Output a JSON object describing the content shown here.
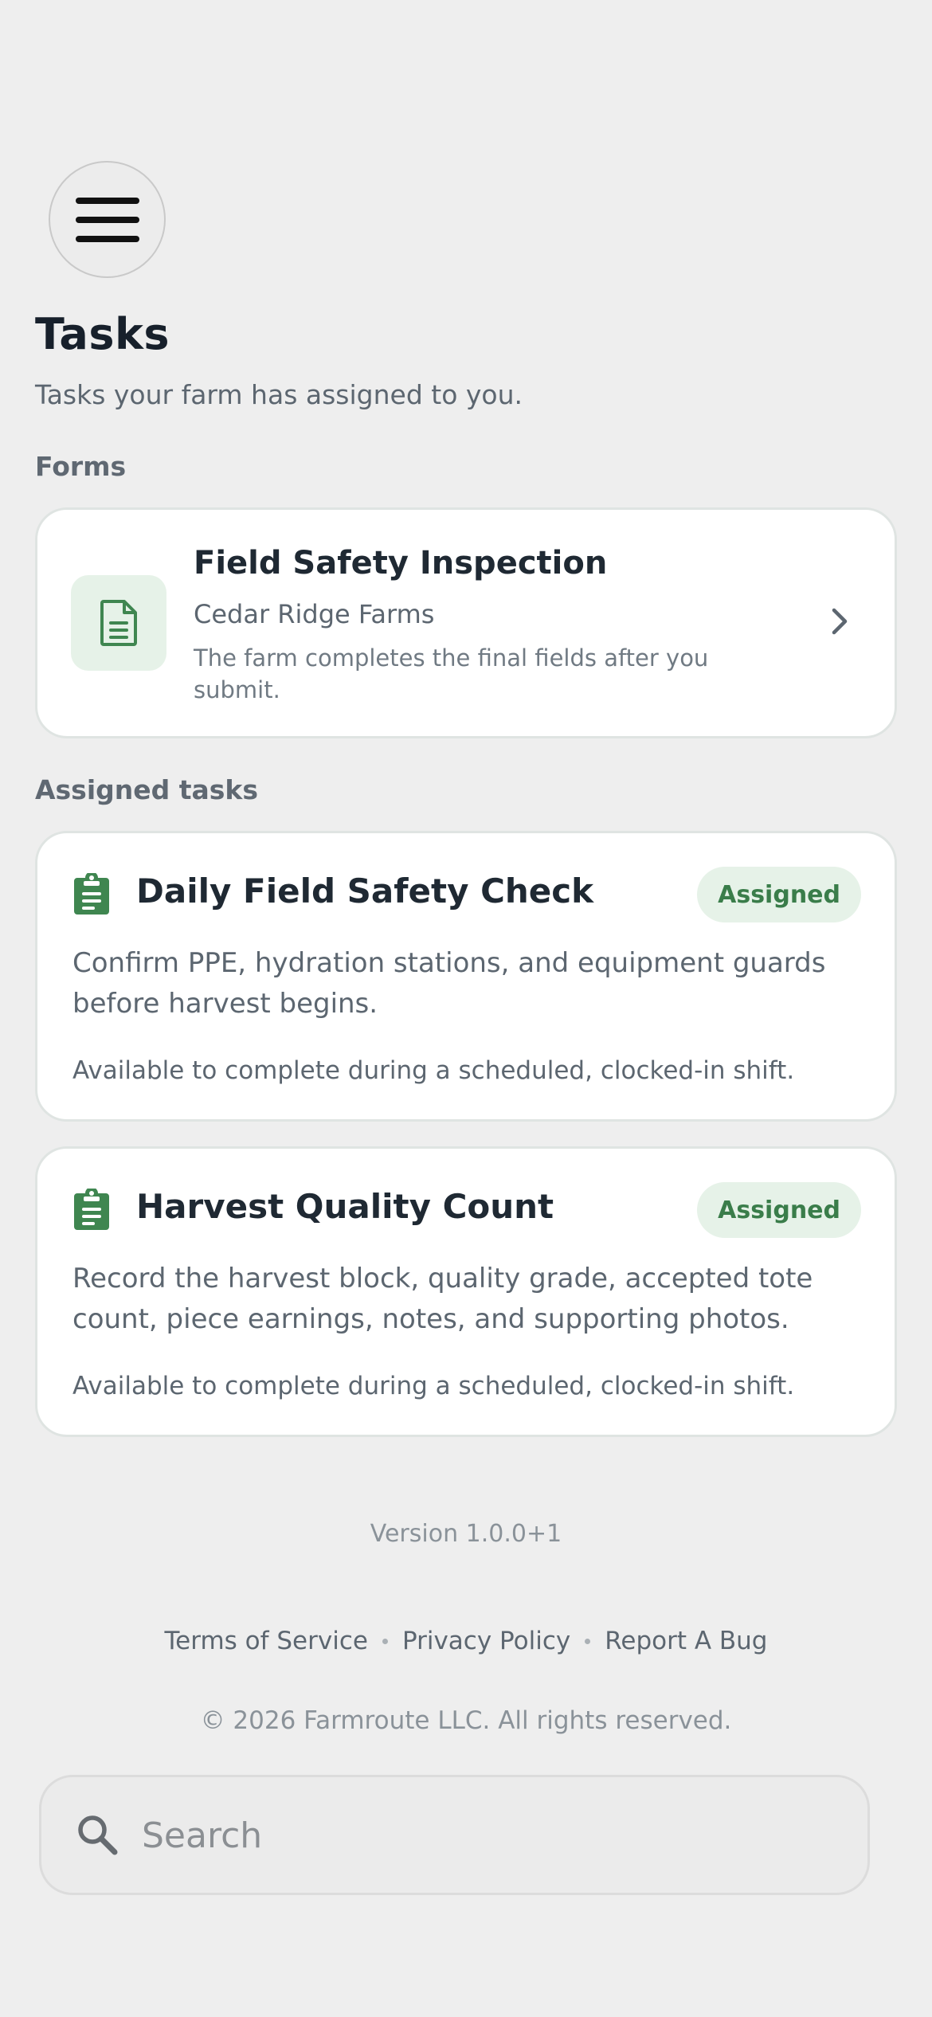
{
  "header": {
    "menu_icon": "hamburger-menu-icon",
    "title": "Tasks",
    "subtitle": "Tasks your farm has assigned to you."
  },
  "forms_section": {
    "label": "Forms",
    "items": [
      {
        "icon": "document-icon",
        "title": "Field Safety Inspection",
        "farm": "Cedar Ridge Farms",
        "note": "The farm completes the final fields after you submit.",
        "chevron_icon": "chevron-right-icon"
      }
    ]
  },
  "tasks_section": {
    "label": "Assigned tasks",
    "items": [
      {
        "icon": "clipboard-icon",
        "title": "Daily Field Safety Check",
        "status": "Assigned",
        "description": "Confirm PPE, hydration stations, and equipment guards before harvest begins.",
        "availability": "Available to complete during a scheduled, clocked-in shift."
      },
      {
        "icon": "clipboard-icon",
        "title": "Harvest Quality Count",
        "status": "Assigned",
        "description": "Record the harvest block, quality grade, accepted tote count, piece earnings, notes, and supporting photos.",
        "availability": "Available to complete during a scheduled, clocked-in shift."
      }
    ]
  },
  "footer": {
    "version": "Version 1.0.0+1",
    "links": {
      "terms": "Terms of Service",
      "privacy": "Privacy Policy",
      "bug": "Report A Bug"
    },
    "copyright": "© 2026 Farmroute LLC. All rights reserved."
  },
  "search": {
    "icon": "search-icon",
    "placeholder": "Search",
    "value": ""
  },
  "colors": {
    "background": "#eeeeee",
    "card": "#ffffff",
    "accent_green": "#3a7d4a",
    "badge_bg": "#e6f2e8",
    "text_primary": "#1f2933",
    "text_secondary": "#5c6670"
  }
}
